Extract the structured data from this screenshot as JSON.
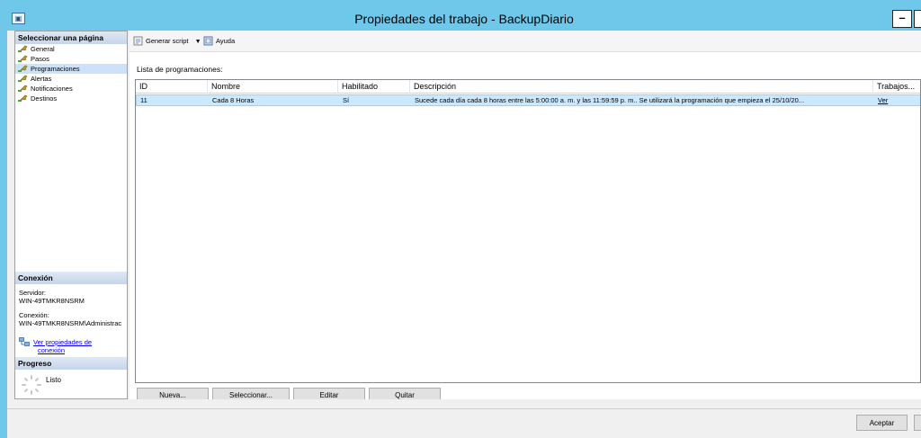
{
  "window": {
    "title": "Propiedades del trabajo - BackupDiario",
    "icon_name": "sql-job-icon",
    "minimize_label": "–",
    "accent_color": "#6fc8ea"
  },
  "sidebar": {
    "header": "Seleccionar una página",
    "items": [
      {
        "label": "General",
        "icon": "wrench-icon"
      },
      {
        "label": "Pasos",
        "icon": "wrench-icon"
      },
      {
        "label": "Programaciones",
        "icon": "wrench-icon"
      },
      {
        "label": "Alertas",
        "icon": "wrench-icon"
      },
      {
        "label": "Notificaciones",
        "icon": "wrench-icon"
      },
      {
        "label": "Destinos",
        "icon": "wrench-icon"
      }
    ],
    "connection": {
      "header": "Conexión",
      "server_label": "Servidor:",
      "server_value": "WIN-49TMKR8NSRM",
      "connection_label": "Conexión:",
      "connection_value": "WIN-49TMKR8NSRM\\Administrac",
      "link_line1": "Ver propiedades de",
      "link_line2": "conexión"
    },
    "progress": {
      "header": "Progreso",
      "status": "Listo"
    }
  },
  "toolbar": {
    "script_label": "Generar script",
    "help_label": "Ayuda"
  },
  "main": {
    "list_label": "Lista de programaciones:",
    "columns": [
      "ID",
      "Nombre",
      "Habilitado",
      "Descripción",
      "Trabajos..."
    ],
    "rows": [
      {
        "id": "11",
        "name": "Cada 8 Horas",
        "enabled": "Sí",
        "description": "Sucede cada día cada 8 horas entre las 5:00:00 a. m. y las 11:59:59 p. m.. Se utilizará la programación que empieza el 25/10/20...",
        "jobs_link": "Ver"
      }
    ],
    "buttons": {
      "new": "Nueva...",
      "select": "Seleccionar...",
      "edit": "Editar",
      "remove": "Quitar"
    }
  },
  "footer": {
    "ok_label": "Aceptar"
  },
  "colors": {
    "selected_row": "#cce8ff",
    "link": "#0000ee"
  }
}
